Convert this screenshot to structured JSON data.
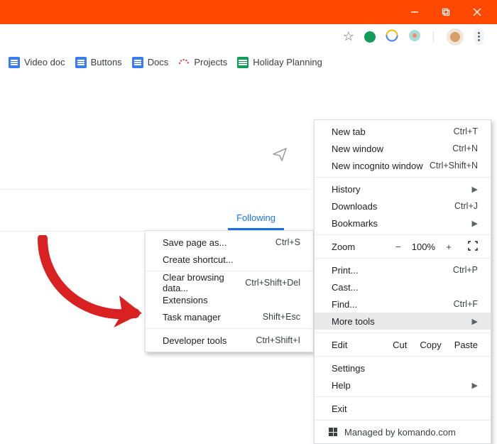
{
  "bookmarks": {
    "videoDoc": "Video doc",
    "buttons": "Buttons",
    "docs": "Docs",
    "projects": "Projects",
    "holiday": "Holiday Planning"
  },
  "tab": {
    "following": "Following"
  },
  "mainMenu": {
    "newTab": "New tab",
    "scNewTab": "Ctrl+T",
    "newWindow": "New window",
    "scNewWindow": "Ctrl+N",
    "newIncog": "New incognito window",
    "scNewIncog": "Ctrl+Shift+N",
    "history": "History",
    "downloads": "Downloads",
    "scDownloads": "Ctrl+J",
    "bookmarks": "Bookmarks",
    "zoomLabel": "Zoom",
    "zoomValue": "100%",
    "print": "Print...",
    "scPrint": "Ctrl+P",
    "cast": "Cast...",
    "find": "Find...",
    "scFind": "Ctrl+F",
    "moreTools": "More tools",
    "editLabel": "Edit",
    "cut": "Cut",
    "copy": "Copy",
    "paste": "Paste",
    "settings": "Settings",
    "help": "Help",
    "exit": "Exit",
    "managed": "Managed by komando.com"
  },
  "subMenu": {
    "savePage": "Save page as...",
    "scSave": "Ctrl+S",
    "createShortcut": "Create shortcut...",
    "clearData": "Clear browsing data...",
    "scClear": "Ctrl+Shift+Del",
    "extensions": "Extensions",
    "taskManager": "Task manager",
    "scTask": "Shift+Esc",
    "devTools": "Developer tools",
    "scDev": "Ctrl+Shift+I"
  }
}
